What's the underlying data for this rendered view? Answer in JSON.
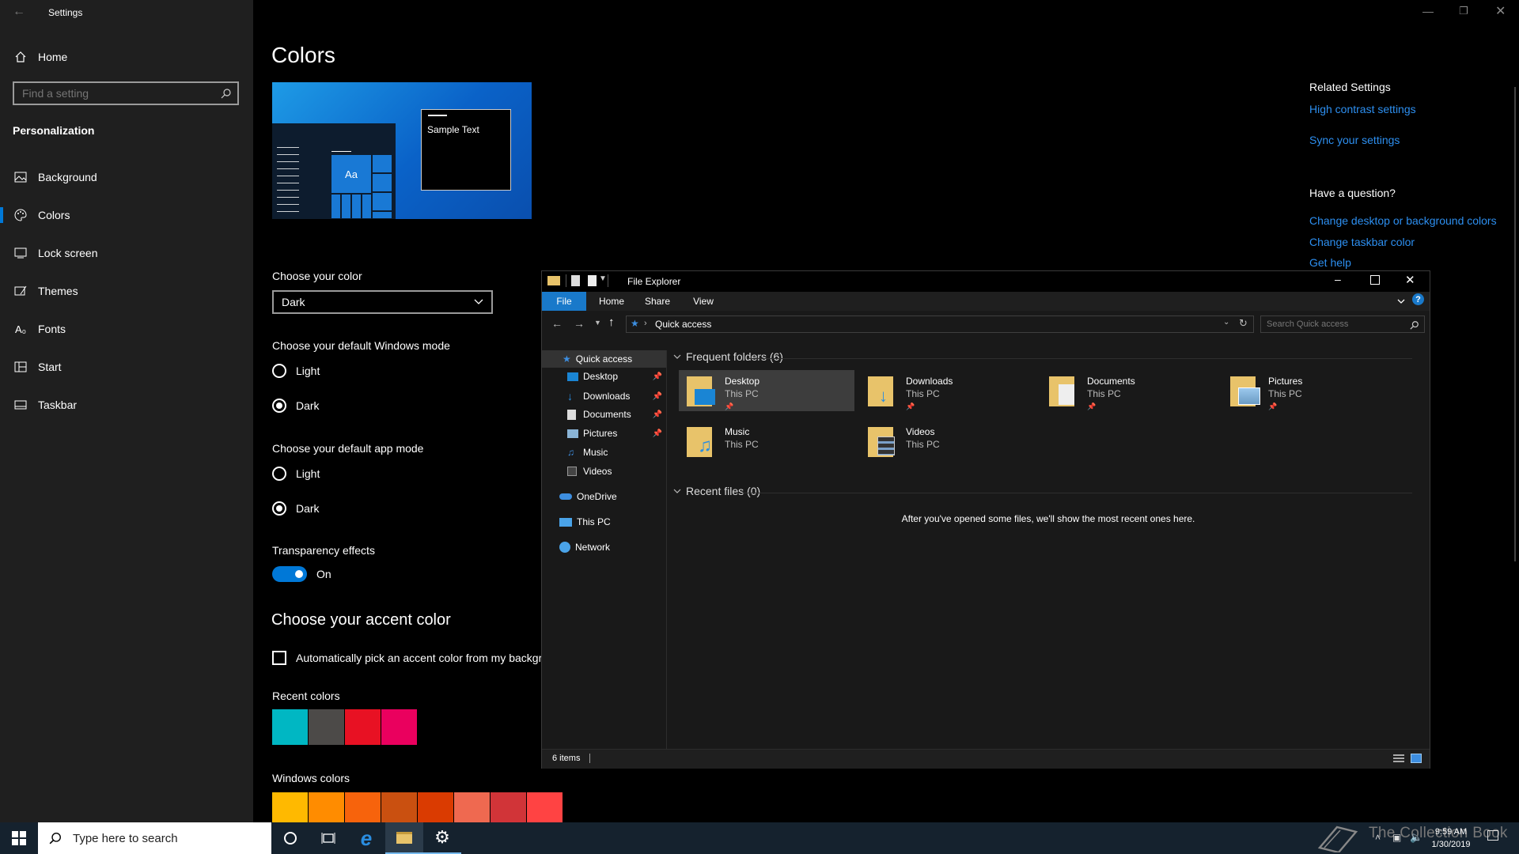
{
  "settings": {
    "window_title": "Settings",
    "home_label": "Home",
    "search_placeholder": "Find a setting",
    "section_title": "Personalization",
    "nav_items": [
      {
        "label": "Background",
        "icon": "image-icon"
      },
      {
        "label": "Colors",
        "icon": "palette-icon",
        "active": true
      },
      {
        "label": "Lock screen",
        "icon": "lock-screen-icon"
      },
      {
        "label": "Themes",
        "icon": "brush-icon"
      },
      {
        "label": "Fonts",
        "icon": "font-icon"
      },
      {
        "label": "Start",
        "icon": "start-icon"
      },
      {
        "label": "Taskbar",
        "icon": "taskbar-icon"
      }
    ]
  },
  "colors": {
    "page_title": "Colors",
    "preview_sample_text": "Sample Text",
    "preview_tile_text": "Aa",
    "choose_color_label": "Choose your color",
    "choose_color_value": "Dark",
    "windows_mode_label": "Choose your default Windows mode",
    "windows_mode_options": [
      "Light",
      "Dark"
    ],
    "windows_mode_selected": "Dark",
    "app_mode_label": "Choose your default app mode",
    "app_mode_options": [
      "Light",
      "Dark"
    ],
    "app_mode_selected": "Dark",
    "transparency_label": "Transparency effects",
    "transparency_state": "On",
    "accent_title": "Choose your accent color",
    "auto_accent_label": "Automatically pick an accent color from my backgr",
    "recent_colors_label": "Recent colors",
    "recent_colors": [
      "#00b7c3",
      "#4c4a48",
      "#e81123",
      "#ea005e"
    ],
    "windows_colors_label": "Windows colors",
    "windows_colors": [
      "#ffb900",
      "#ff8c00",
      "#f7630c",
      "#ca5010",
      "#da3b01",
      "#ef6950",
      "#d13438",
      "#ff4343"
    ]
  },
  "related": {
    "related_title": "Related Settings",
    "high_contrast": "High contrast settings",
    "sync": "Sync your settings",
    "question_title": "Have a question?",
    "change_colors": "Change desktop or background colors",
    "change_taskbar": "Change taskbar color",
    "get_help": "Get help"
  },
  "explorer": {
    "title": "File Explorer",
    "tabs": [
      "File",
      "Home",
      "Share",
      "View"
    ],
    "address": "Quick access",
    "search_placeholder": "Search Quick access",
    "tree": {
      "quick_access": "Quick access",
      "pinned": [
        "Desktop",
        "Downloads",
        "Documents",
        "Pictures"
      ],
      "unpinned": [
        "Music",
        "Videos"
      ],
      "onedrive": "OneDrive",
      "this_pc": "This PC",
      "network": "Network"
    },
    "frequent_header": "Frequent folders (6)",
    "folders": [
      {
        "name": "Desktop",
        "location": "This PC",
        "pinned": true
      },
      {
        "name": "Downloads",
        "location": "This PC",
        "pinned": true
      },
      {
        "name": "Documents",
        "location": "This PC",
        "pinned": true
      },
      {
        "name": "Pictures",
        "location": "This PC",
        "pinned": true
      },
      {
        "name": "Music",
        "location": "This PC",
        "pinned": false
      },
      {
        "name": "Videos",
        "location": "This PC",
        "pinned": false
      }
    ],
    "recent_header": "Recent files (0)",
    "recent_empty": "After you've opened some files, we'll show the most recent ones here.",
    "status": "6 items"
  },
  "taskbar": {
    "search_placeholder": "Type here to search",
    "time": "9:59 AM",
    "date": "1/30/2019",
    "watermark": "The Collection Book"
  }
}
